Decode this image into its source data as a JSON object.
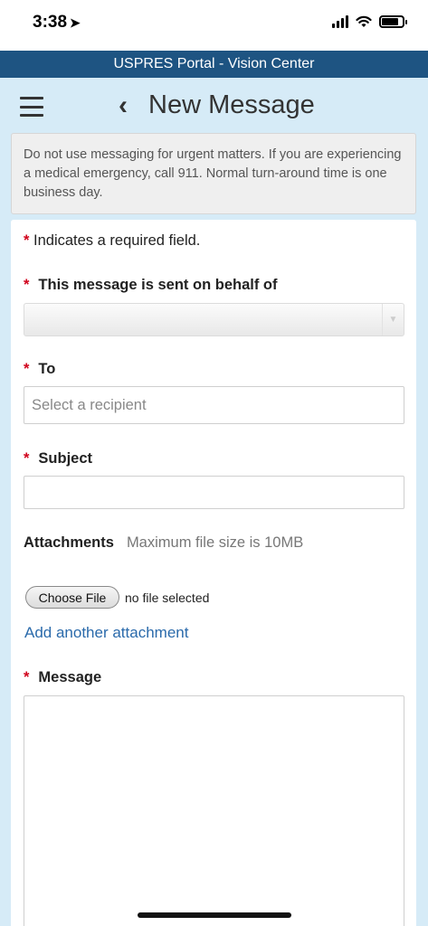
{
  "status_bar": {
    "time": "3:38",
    "location_icon": "location-arrow-icon",
    "signal_icon": "cellular-signal-icon",
    "wifi_icon": "wifi-icon",
    "battery_icon": "battery-icon",
    "battery_level": 0.8
  },
  "portal": {
    "title": "USPRES Portal - Vision Center"
  },
  "header": {
    "menu_icon": "hamburger-menu-icon",
    "back_icon": "chevron-left-icon",
    "back_glyph": "‹",
    "title": "New Message"
  },
  "notice": {
    "text": "Do not use messaging for urgent matters. If you are experiencing a medical emergency, call 911. Normal turn-around time is one business day."
  },
  "form": {
    "required_marker": "*",
    "required_note": "Indicates a required field.",
    "behalf_label": "This message is sent on behalf of",
    "behalf_value": "",
    "dropdown_arrow_glyph": "▼",
    "to_label": "To",
    "to_placeholder": "Select a recipient",
    "to_value": "",
    "subject_label": "Subject",
    "subject_value": "",
    "attachments_label": "Attachments",
    "attachments_hint": "Maximum file size is 10MB",
    "choose_file_label": "Choose File",
    "file_status": "no file selected",
    "add_attachment_link": "Add another attachment",
    "message_label": "Message",
    "message_value": ""
  },
  "colors": {
    "portal_bar": "#1e5482",
    "page_background": "#d6ebf7",
    "required_asterisk": "#d0021b",
    "link": "#2a6aab"
  }
}
